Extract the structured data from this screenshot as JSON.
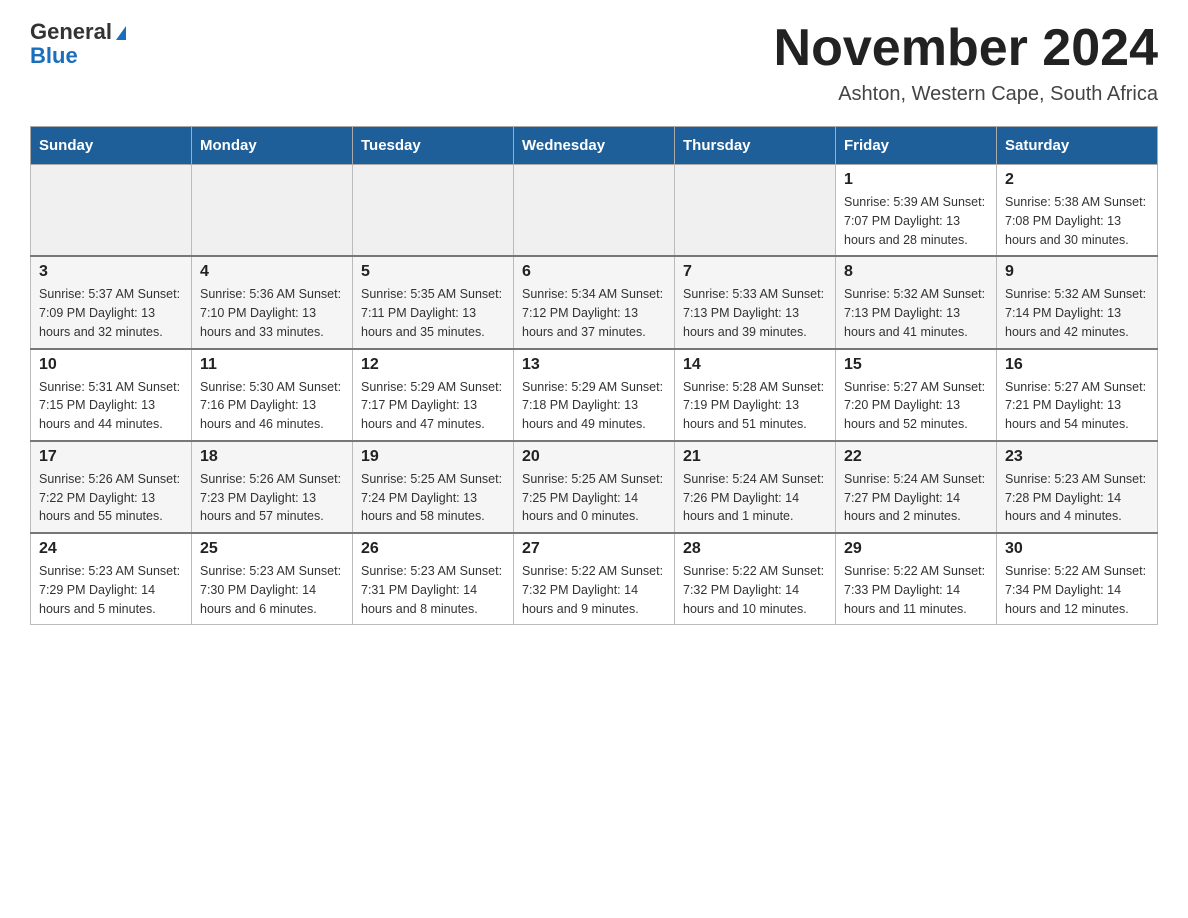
{
  "header": {
    "logo_line1": "General",
    "logo_line2": "Blue",
    "month_title": "November 2024",
    "location": "Ashton, Western Cape, South Africa"
  },
  "days_of_week": [
    "Sunday",
    "Monday",
    "Tuesday",
    "Wednesday",
    "Thursday",
    "Friday",
    "Saturday"
  ],
  "weeks": [
    {
      "days": [
        {
          "number": "",
          "info": ""
        },
        {
          "number": "",
          "info": ""
        },
        {
          "number": "",
          "info": ""
        },
        {
          "number": "",
          "info": ""
        },
        {
          "number": "",
          "info": ""
        },
        {
          "number": "1",
          "info": "Sunrise: 5:39 AM\nSunset: 7:07 PM\nDaylight: 13 hours and 28 minutes."
        },
        {
          "number": "2",
          "info": "Sunrise: 5:38 AM\nSunset: 7:08 PM\nDaylight: 13 hours and 30 minutes."
        }
      ]
    },
    {
      "days": [
        {
          "number": "3",
          "info": "Sunrise: 5:37 AM\nSunset: 7:09 PM\nDaylight: 13 hours and 32 minutes."
        },
        {
          "number": "4",
          "info": "Sunrise: 5:36 AM\nSunset: 7:10 PM\nDaylight: 13 hours and 33 minutes."
        },
        {
          "number": "5",
          "info": "Sunrise: 5:35 AM\nSunset: 7:11 PM\nDaylight: 13 hours and 35 minutes."
        },
        {
          "number": "6",
          "info": "Sunrise: 5:34 AM\nSunset: 7:12 PM\nDaylight: 13 hours and 37 minutes."
        },
        {
          "number": "7",
          "info": "Sunrise: 5:33 AM\nSunset: 7:13 PM\nDaylight: 13 hours and 39 minutes."
        },
        {
          "number": "8",
          "info": "Sunrise: 5:32 AM\nSunset: 7:13 PM\nDaylight: 13 hours and 41 minutes."
        },
        {
          "number": "9",
          "info": "Sunrise: 5:32 AM\nSunset: 7:14 PM\nDaylight: 13 hours and 42 minutes."
        }
      ]
    },
    {
      "days": [
        {
          "number": "10",
          "info": "Sunrise: 5:31 AM\nSunset: 7:15 PM\nDaylight: 13 hours and 44 minutes."
        },
        {
          "number": "11",
          "info": "Sunrise: 5:30 AM\nSunset: 7:16 PM\nDaylight: 13 hours and 46 minutes."
        },
        {
          "number": "12",
          "info": "Sunrise: 5:29 AM\nSunset: 7:17 PM\nDaylight: 13 hours and 47 minutes."
        },
        {
          "number": "13",
          "info": "Sunrise: 5:29 AM\nSunset: 7:18 PM\nDaylight: 13 hours and 49 minutes."
        },
        {
          "number": "14",
          "info": "Sunrise: 5:28 AM\nSunset: 7:19 PM\nDaylight: 13 hours and 51 minutes."
        },
        {
          "number": "15",
          "info": "Sunrise: 5:27 AM\nSunset: 7:20 PM\nDaylight: 13 hours and 52 minutes."
        },
        {
          "number": "16",
          "info": "Sunrise: 5:27 AM\nSunset: 7:21 PM\nDaylight: 13 hours and 54 minutes."
        }
      ]
    },
    {
      "days": [
        {
          "number": "17",
          "info": "Sunrise: 5:26 AM\nSunset: 7:22 PM\nDaylight: 13 hours and 55 minutes."
        },
        {
          "number": "18",
          "info": "Sunrise: 5:26 AM\nSunset: 7:23 PM\nDaylight: 13 hours and 57 minutes."
        },
        {
          "number": "19",
          "info": "Sunrise: 5:25 AM\nSunset: 7:24 PM\nDaylight: 13 hours and 58 minutes."
        },
        {
          "number": "20",
          "info": "Sunrise: 5:25 AM\nSunset: 7:25 PM\nDaylight: 14 hours and 0 minutes."
        },
        {
          "number": "21",
          "info": "Sunrise: 5:24 AM\nSunset: 7:26 PM\nDaylight: 14 hours and 1 minute."
        },
        {
          "number": "22",
          "info": "Sunrise: 5:24 AM\nSunset: 7:27 PM\nDaylight: 14 hours and 2 minutes."
        },
        {
          "number": "23",
          "info": "Sunrise: 5:23 AM\nSunset: 7:28 PM\nDaylight: 14 hours and 4 minutes."
        }
      ]
    },
    {
      "days": [
        {
          "number": "24",
          "info": "Sunrise: 5:23 AM\nSunset: 7:29 PM\nDaylight: 14 hours and 5 minutes."
        },
        {
          "number": "25",
          "info": "Sunrise: 5:23 AM\nSunset: 7:30 PM\nDaylight: 14 hours and 6 minutes."
        },
        {
          "number": "26",
          "info": "Sunrise: 5:23 AM\nSunset: 7:31 PM\nDaylight: 14 hours and 8 minutes."
        },
        {
          "number": "27",
          "info": "Sunrise: 5:22 AM\nSunset: 7:32 PM\nDaylight: 14 hours and 9 minutes."
        },
        {
          "number": "28",
          "info": "Sunrise: 5:22 AM\nSunset: 7:32 PM\nDaylight: 14 hours and 10 minutes."
        },
        {
          "number": "29",
          "info": "Sunrise: 5:22 AM\nSunset: 7:33 PM\nDaylight: 14 hours and 11 minutes."
        },
        {
          "number": "30",
          "info": "Sunrise: 5:22 AM\nSunset: 7:34 PM\nDaylight: 14 hours and 12 minutes."
        }
      ]
    }
  ]
}
